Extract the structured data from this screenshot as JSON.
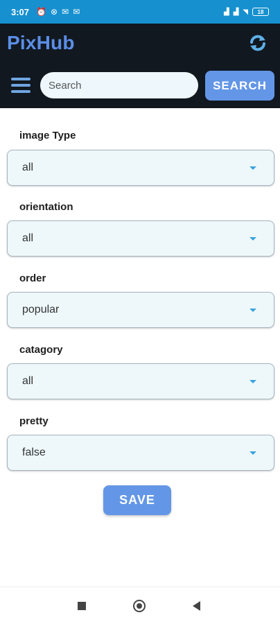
{
  "status_bar": {
    "time": "3:07",
    "battery": "18",
    "left_icons": [
      "alarm-icon",
      "sync-status-icon",
      "gmail-icon",
      "gmail-icon"
    ],
    "right_icons": [
      "signal-icon",
      "signal-icon",
      "wifi-icon",
      "battery-icon"
    ]
  },
  "header": {
    "title": "PixHub",
    "search_placeholder": "Search",
    "search_value": "",
    "search_button": "SEARCH"
  },
  "form": {
    "fields": [
      {
        "label": "image Type",
        "value": "all"
      },
      {
        "label": "orientation",
        "value": "all"
      },
      {
        "label": "order",
        "value": "popular"
      },
      {
        "label": "catagory",
        "value": "all"
      },
      {
        "label": "pretty",
        "value": "false"
      }
    ],
    "save_button": "SAVE"
  },
  "colors": {
    "status_bar": "#1690cf",
    "header_bg": "#111820",
    "accent": "#6396e6",
    "field_bg": "#eef8fb"
  }
}
